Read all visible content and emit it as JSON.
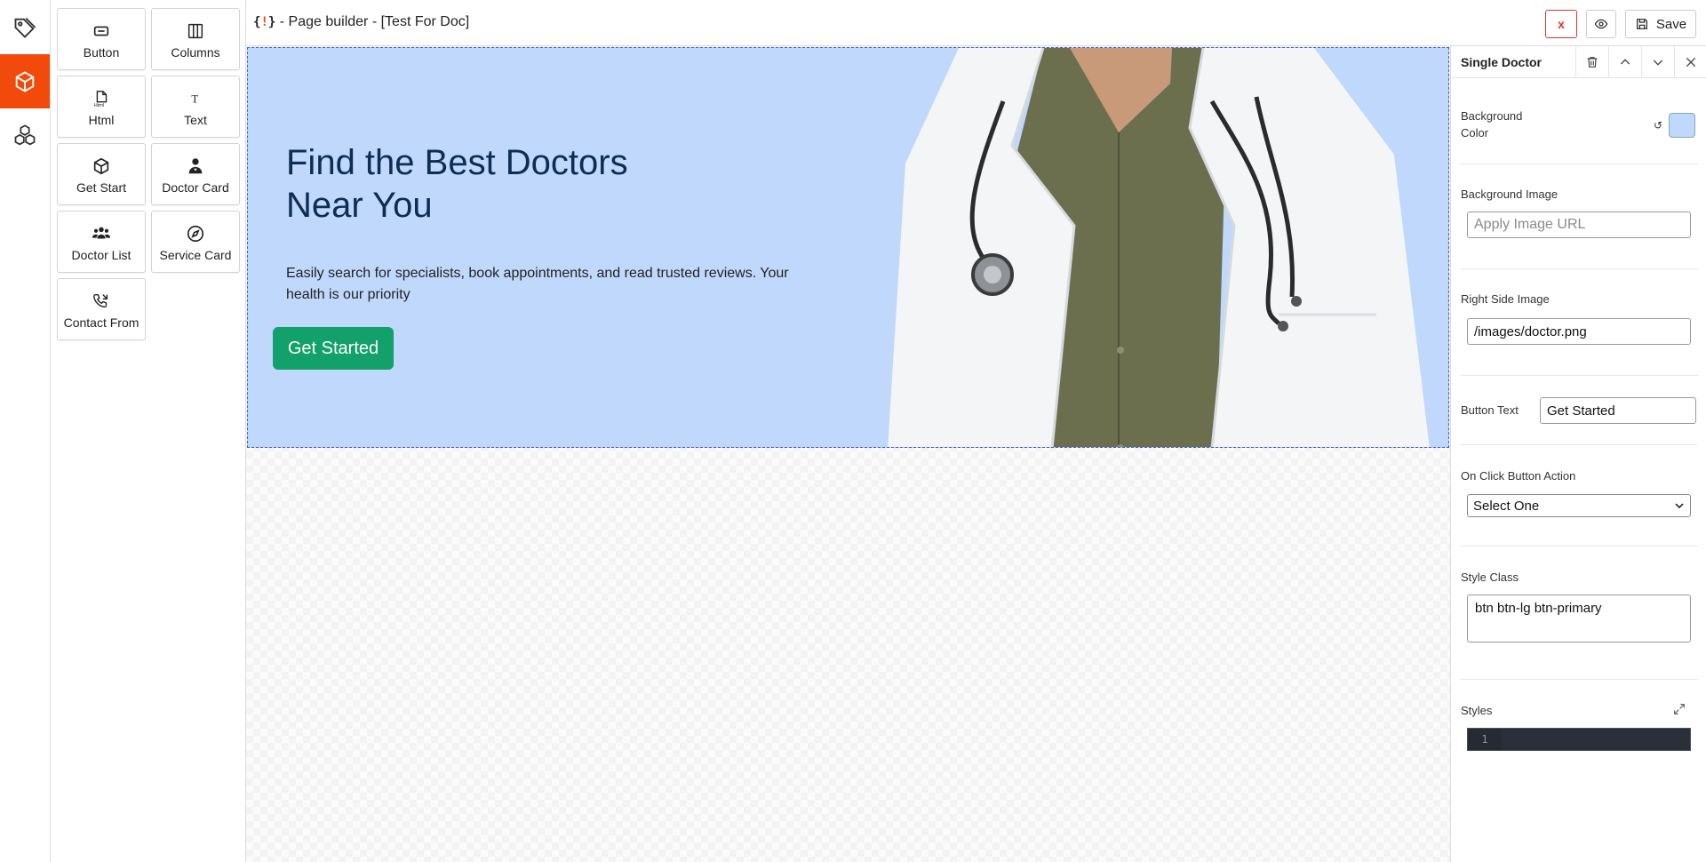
{
  "rail": {
    "items": [
      {
        "icon": "tag-icon",
        "active": false
      },
      {
        "icon": "box-icon",
        "active": true
      },
      {
        "icon": "boxes-icon",
        "active": false
      }
    ]
  },
  "palette": {
    "components": [
      {
        "label": "Button",
        "icon": "button-icon"
      },
      {
        "label": "Columns",
        "icon": "columns-icon"
      },
      {
        "label": "Html",
        "icon": "html-icon"
      },
      {
        "label": "Text",
        "icon": "text-icon"
      },
      {
        "label": "Get Start",
        "icon": "box-icon"
      },
      {
        "label": "Doctor Card",
        "icon": "doctor-icon"
      },
      {
        "label": "Doctor List",
        "icon": "users-icon"
      },
      {
        "label": "Service Card",
        "icon": "compass-icon"
      },
      {
        "label": "Contact From",
        "icon": "phone-icon"
      }
    ]
  },
  "topbar": {
    "logo": "{!}",
    "title": " - Page builder - [Test For Doc]",
    "close_label": "x",
    "save_label": "Save"
  },
  "hero": {
    "heading": "Find the Best Doctors Near You",
    "subtext": "Easily search for specialists, book appointments, and read trusted reviews. Your health is our priority",
    "button_label": "Get Started",
    "background_color": "#bfd8fb",
    "button_color": "#12a06b",
    "heading_color": "#0f2c55"
  },
  "panel": {
    "title": "Single Doctor",
    "background_color_label": "Background Color",
    "background_color_value": "#bfd8fb",
    "background_image_label": "Background Image",
    "background_image_placeholder": "Apply Image URL",
    "right_image_label": "Right Side Image",
    "right_image_value": "/images/doctor.png",
    "button_text_label": "Button Text",
    "button_text_value": "Get Started",
    "on_click_label": "On Click Button Action",
    "on_click_value": "Select One",
    "style_class_label": "Style Class",
    "style_class_value": "btn btn-lg btn-primary",
    "styles_label": "Styles",
    "editor_line": "1"
  },
  "accent_color": "#f24a0a"
}
